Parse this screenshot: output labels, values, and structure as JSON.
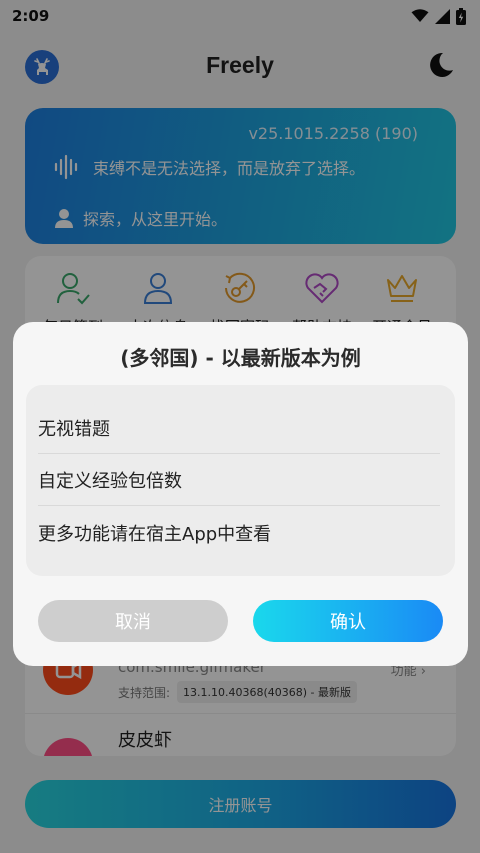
{
  "status_bar": {
    "time": "2:09"
  },
  "app_bar": {
    "title": "Freely"
  },
  "banner": {
    "version": "v25.1015.2258 (190)",
    "quote": "束缚不是无法选择，而是放弃了选择。",
    "explore": "探索，从这里开始。"
  },
  "features": [
    {
      "label": "每日签到",
      "icon": "user-check-icon",
      "color": "#3aa86b"
    },
    {
      "label": "本次信息",
      "icon": "user-icon",
      "color": "#3a7fd6"
    },
    {
      "label": "找回密码",
      "icon": "key-reset-icon",
      "color": "#e39a2b"
    },
    {
      "label": "帮助支持",
      "icon": "heart-handshake-icon",
      "color": "#b04ac7"
    },
    {
      "label": "开通会员",
      "icon": "crown-icon",
      "color": "#e8a92b"
    }
  ],
  "app_list": {
    "items": [
      {
        "package": "com.smile.gifmaker",
        "func": "功能",
        "range_label": "支持范围:",
        "range_value": "13.1.10.40368(40368) - 最新版"
      },
      {
        "name": "皮皮虾"
      }
    ]
  },
  "register_button": "注册账号",
  "dialog": {
    "title": "(多邻国) - 以最新版本为例",
    "options": [
      "无视错题",
      "自定义经验包倍数",
      "更多功能请在宿主App中查看"
    ],
    "cancel": "取消",
    "confirm": "确认"
  },
  "colors": {
    "accent": "#1a8af5",
    "banner_start": "#1e7fe0",
    "banner_end": "#1fc6e0"
  }
}
